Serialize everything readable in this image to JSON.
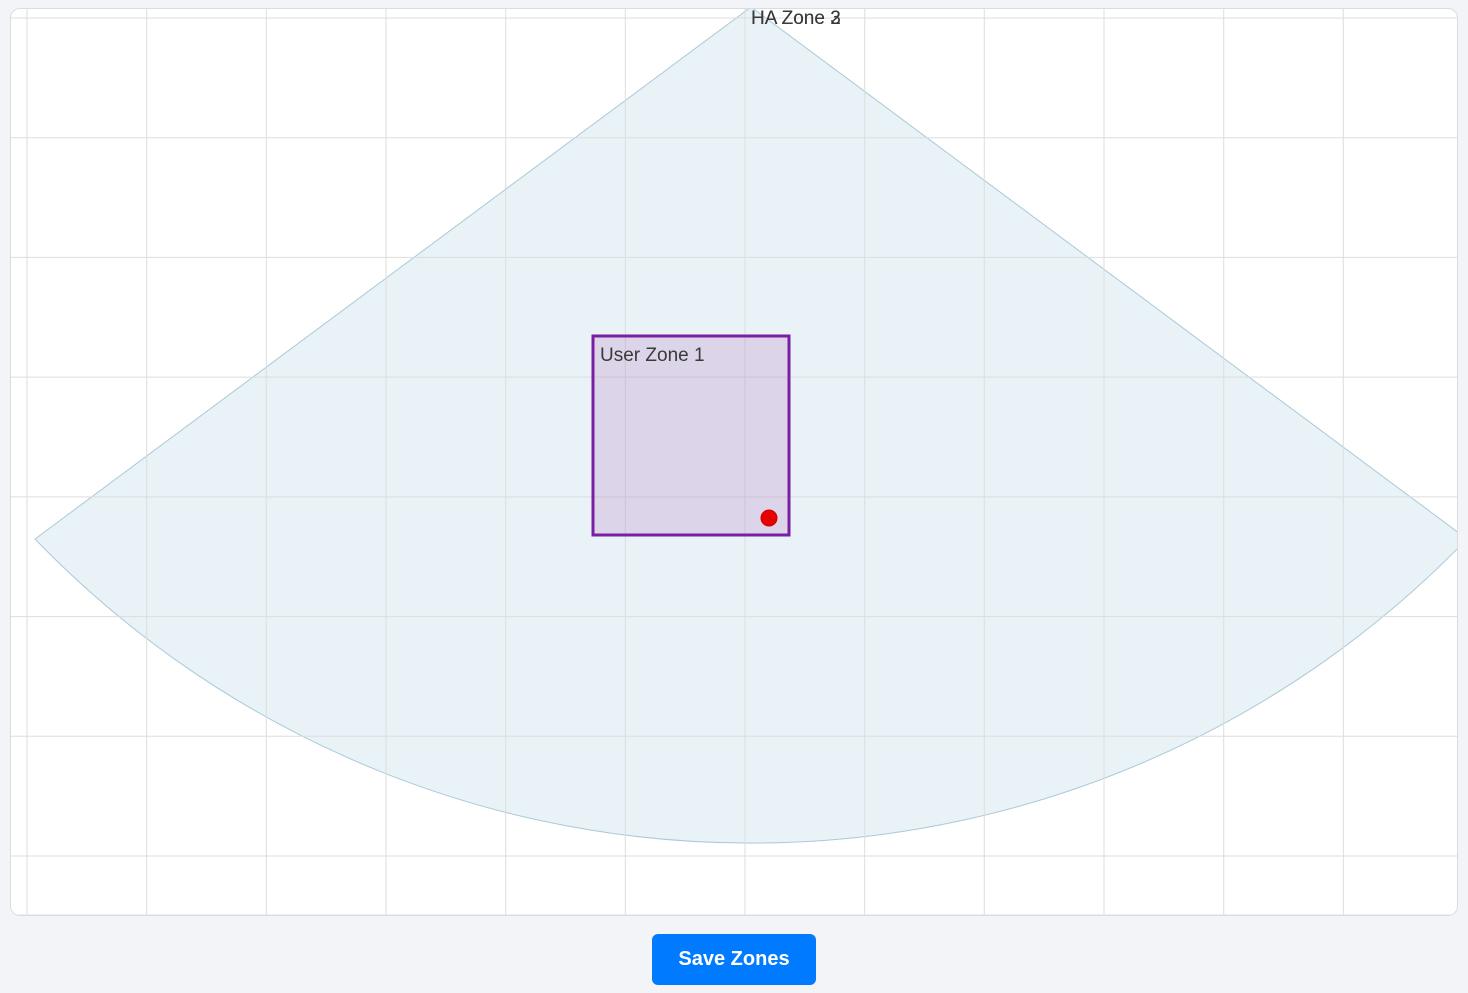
{
  "zones": {
    "ha_zone_label_1": "HA Zone 2",
    "ha_zone_label_2": "HA Zone 3",
    "user_zone_1_label": "User Zone 1"
  },
  "buttons": {
    "save": "Save Zones"
  },
  "colors": {
    "coverage_fill": "#e9f2f6",
    "coverage_stroke": "#aac9d8",
    "grid": "#dddddd",
    "user_zone_stroke": "#7b1fa2",
    "user_zone_fill": "rgba(128,0,128,0.12)",
    "target_dot": "#e60000",
    "primary_button": "#007bff"
  }
}
